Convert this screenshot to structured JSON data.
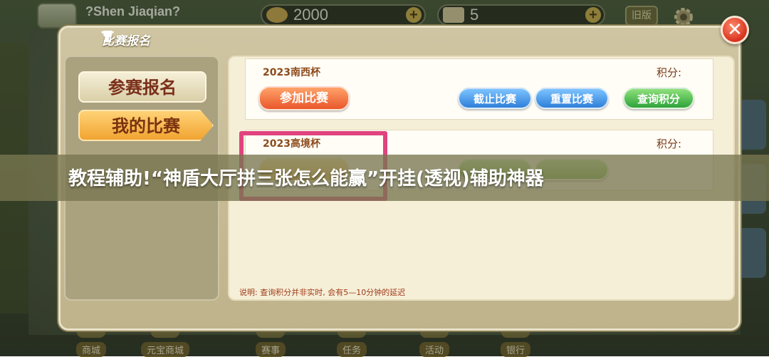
{
  "header": {
    "username": "?Shen Jiaqian?",
    "gold": "2000",
    "tickets": "5",
    "old_version_label": "旧版"
  },
  "dialog": {
    "title": "比赛报名",
    "tabs": [
      {
        "label": "参赛报名"
      },
      {
        "label": "我的比赛"
      }
    ],
    "matches": [
      {
        "name": "2023南西杯",
        "score_label": "积分:",
        "join_label": "参加比赛",
        "deadline_label": "截止比赛",
        "reset_label": "重置比赛",
        "query_label": "查询积分"
      },
      {
        "name": "2023高境杯",
        "score_label": "积分:"
      }
    ],
    "note": "说明: 查询积分并非实时, 会有5—10分钟的延迟",
    "close_symbol": "✕"
  },
  "banner": {
    "text": "教程辅助!“神盾大厅拼三张怎么能赢”开挂(透视)辅助神器"
  },
  "bottom_nav": [
    {
      "label": "商城",
      "icon": "shop-icon"
    },
    {
      "label": "元宝商城",
      "icon": "ingot-icon"
    },
    {
      "label": "赛事",
      "icon": "trophy-icon"
    },
    {
      "label": "任务",
      "icon": "task-icon"
    },
    {
      "label": "活动",
      "icon": "gift-icon"
    },
    {
      "label": "银行",
      "icon": "bank-icon"
    }
  ],
  "colors": {
    "accent_orange": "#e9572a",
    "accent_blue": "#2f7fd9",
    "accent_green": "#2ea33b",
    "highlight": "#e0437e"
  }
}
